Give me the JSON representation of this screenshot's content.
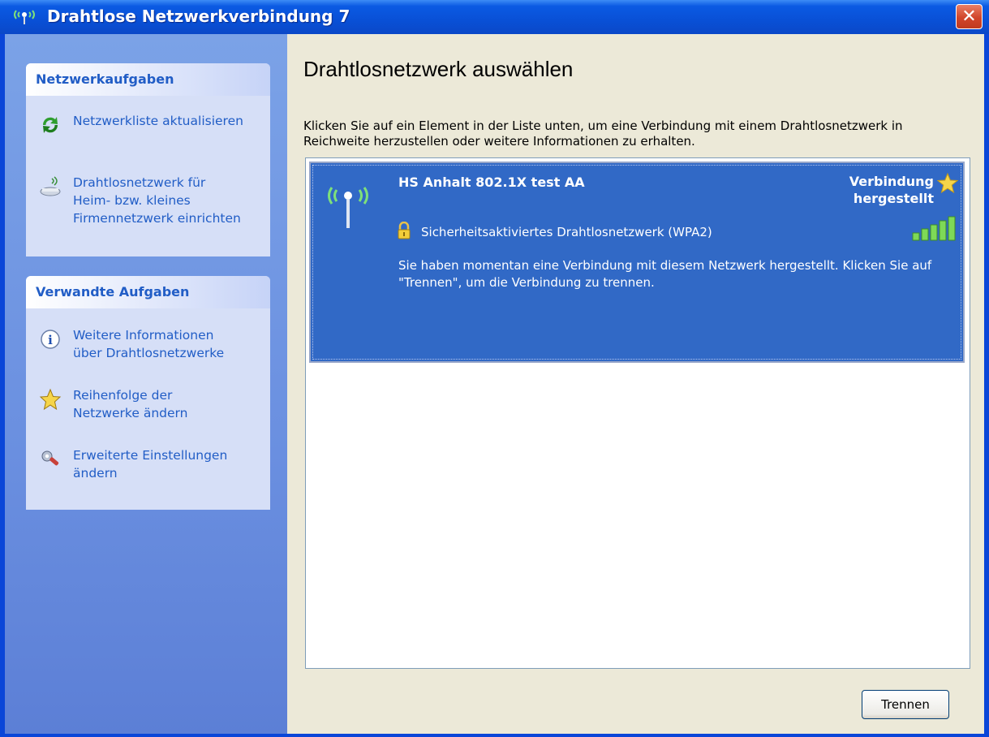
{
  "window": {
    "title": "Drahtlose Netzwerkverbindung 7"
  },
  "sidebar": {
    "network_tasks": {
      "header": "Netzwerkaufgaben",
      "items": [
        {
          "label": "Netzwerkliste aktualisieren",
          "icon": "refresh-icon"
        },
        {
          "label": "Drahtlosnetzwerk für\nHeim- bzw. kleines\nFirmennetzwerk einrichten",
          "icon": "wireless-setup-icon"
        }
      ]
    },
    "related_tasks": {
      "header": "Verwandte Aufgaben",
      "items": [
        {
          "label": "Weitere Informationen\nüber Drahtlosnetzwerke",
          "icon": "info-icon"
        },
        {
          "label": "Reihenfolge der\nNetzwerke ändern",
          "icon": "star-icon"
        },
        {
          "label": "Erweiterte Einstellungen\nändern",
          "icon": "settings-icon"
        }
      ]
    }
  },
  "main": {
    "heading": "Drahtlosnetzwerk auswählen",
    "description": "Klicken Sie auf ein Element in der Liste unten, um eine Verbindung mit einem Drahtlosnetzwerk in Reichweite herzustellen oder weitere Informationen zu erhalten.",
    "networks": [
      {
        "name": "HS Anhalt 802.1X test AA",
        "status": "Verbindung hergestellt",
        "security": "Sicherheitsaktiviertes Drahtlosnetzwerk (WPA2)",
        "message": "Sie haben momentan eine Verbindung mit diesem Netzwerk hergestellt. Klicken Sie auf \"Trennen\", um die Verbindung zu trennen.",
        "signal_bars": 5
      }
    ],
    "disconnect_button": "Trennen"
  },
  "colors": {
    "titlebar": "#0b5ae3",
    "selection": "#3169c6",
    "link": "#215dc6",
    "sidebar": "#6a8fe0"
  }
}
